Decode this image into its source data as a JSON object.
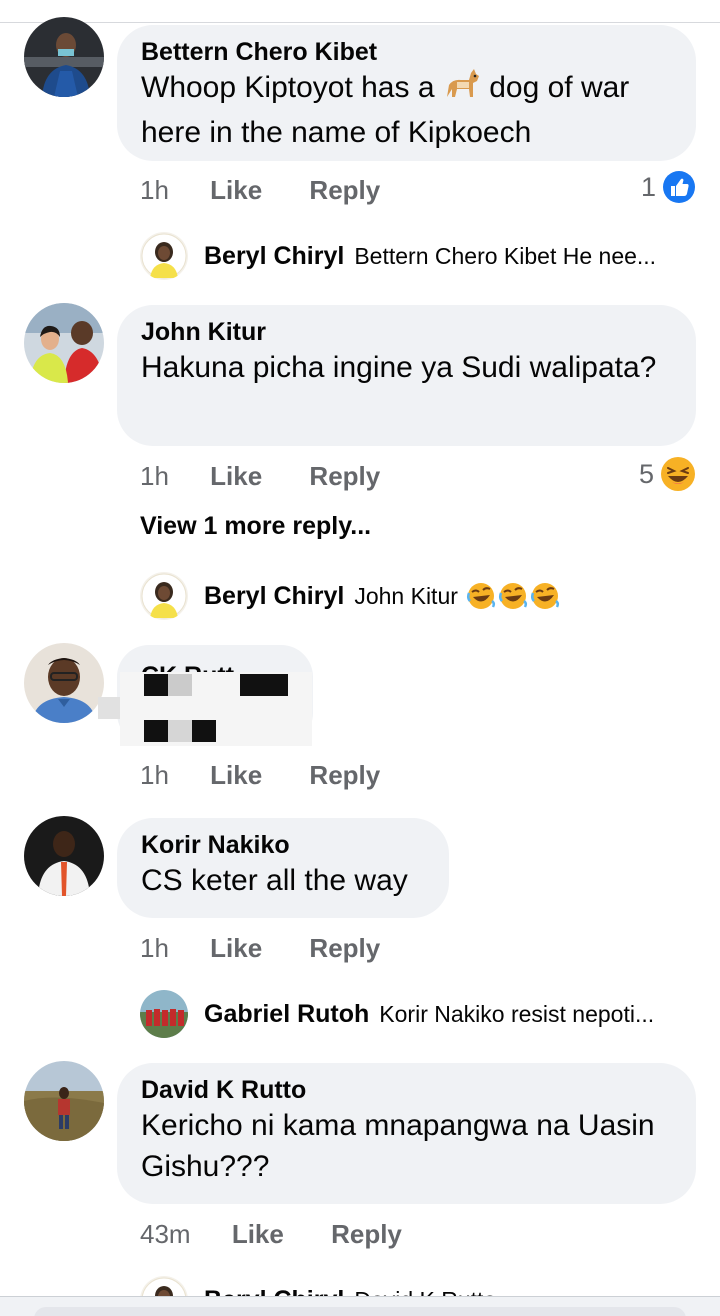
{
  "comments": [
    {
      "author": "Bettern Chero Kibet",
      "text_before": "Whoop Kiptoyot has a ",
      "text_after": " dog  of war here in the name of Kipkoech",
      "time": "1h",
      "like": "Like",
      "reply": "Reply",
      "reaction": {
        "count": "1",
        "icon": "like-icon",
        "color": "#1877f2"
      },
      "reply_preview": {
        "name": "Beryl Chiryl",
        "text": "Bettern Chero Kibet He nee..."
      }
    },
    {
      "author": "John Kitur",
      "text": "Hakuna picha ingine ya Sudi walipata?",
      "time": "1h",
      "like": "Like",
      "reply": "Reply",
      "reaction": {
        "count": "5",
        "icon": "laughing-emoji-icon"
      },
      "view_more": "View 1 more reply...",
      "reply_preview": {
        "name": "Beryl Chiryl",
        "text": "John Kitur"
      }
    },
    {
      "author": "CK Rutt...",
      "time": "1h",
      "like": "Like",
      "reply": "Reply"
    },
    {
      "author": "Korir Nakiko",
      "text": "CS keter all the way",
      "time": "1h",
      "like": "Like",
      "reply": "Reply",
      "reply_preview": {
        "name": "Gabriel Rutoh",
        "text": "Korir Nakiko resist nepoti..."
      }
    },
    {
      "author": "David K Rutto",
      "text": "Kericho ni kama mnapangwa na Uasin Gishu???",
      "time": "43m",
      "like": "Like",
      "reply": "Reply",
      "reply_preview": {
        "name": "Beryl Chiryl",
        "text": "David K Rutto ..."
      }
    }
  ],
  "colors": {
    "meta": "#65676b",
    "bubble": "#f0f2f5",
    "like_blue": "#1877f2"
  }
}
